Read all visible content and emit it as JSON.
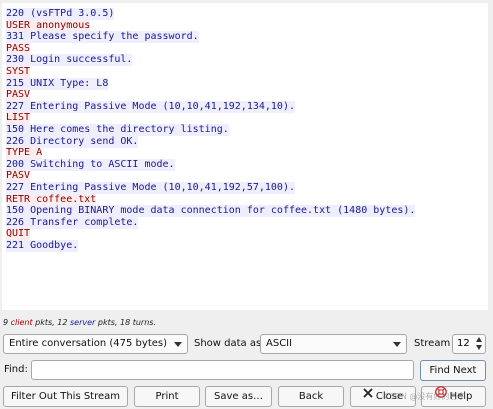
{
  "stream_lines": [
    {
      "text": "220 (vsFTPd 3.0.5)",
      "dir": "server"
    },
    {
      "text": "USER anonymous",
      "dir": "client"
    },
    {
      "text": "331 Please specify the password.",
      "dir": "server"
    },
    {
      "text": "PASS",
      "dir": "client"
    },
    {
      "text": "230 Login successful.",
      "dir": "server"
    },
    {
      "text": "SYST",
      "dir": "client"
    },
    {
      "text": "215 UNIX Type: L8",
      "dir": "server"
    },
    {
      "text": "PASV",
      "dir": "client"
    },
    {
      "text": "227 Entering Passive Mode (10,10,41,192,134,10).",
      "dir": "server"
    },
    {
      "text": "LIST",
      "dir": "client"
    },
    {
      "text": "150 Here comes the directory listing.",
      "dir": "server"
    },
    {
      "text": "226 Directory send OK.",
      "dir": "server"
    },
    {
      "text": "TYPE A",
      "dir": "client"
    },
    {
      "text": "200 Switching to ASCII mode.",
      "dir": "server"
    },
    {
      "text": "PASV",
      "dir": "client"
    },
    {
      "text": "227 Entering Passive Mode (10,10,41,192,57,100).",
      "dir": "server"
    },
    {
      "text": "RETR coffee.txt",
      "dir": "client"
    },
    {
      "text": "150 Opening BINARY mode data connection for coffee.txt (1480 bytes).",
      "dir": "server"
    },
    {
      "text": "226 Transfer complete.",
      "dir": "server"
    },
    {
      "text": "QUIT",
      "dir": "client"
    },
    {
      "text": "221 Goodbye.",
      "dir": "server"
    }
  ],
  "status": {
    "client_count": "9",
    "client_word": "client",
    "mid": " pkts, 12 ",
    "server_word": "server",
    "tail": " pkts, 18 turns."
  },
  "controls": {
    "conversation_select": "Entire conversation (475 bytes)",
    "show_data_label": "Show data as",
    "show_data_select": "ASCII",
    "stream_label": "Stream",
    "stream_value": "12",
    "find_label": "Find:",
    "find_value": "",
    "find_next": "Find Next"
  },
  "buttons": {
    "filter_out": "Filter Out This Stream",
    "print": "Print",
    "save_as": "Save as…",
    "back": "Back",
    "close": "Close",
    "help": "Help"
  },
  "watermark": "CSDN @没有好的名字"
}
